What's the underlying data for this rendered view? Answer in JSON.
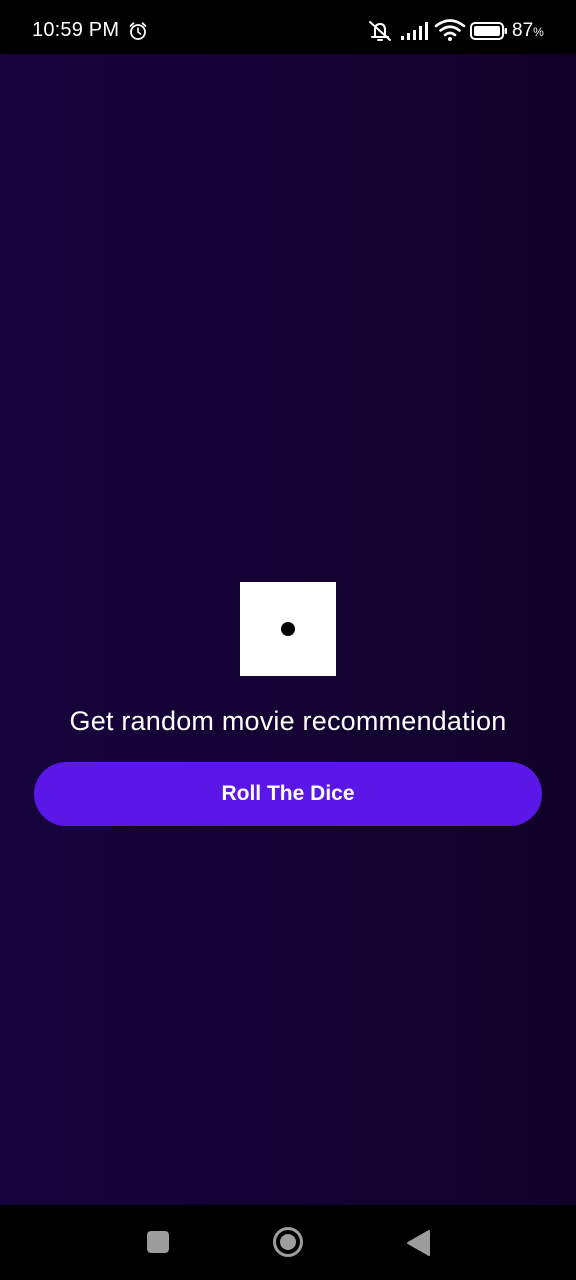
{
  "status_bar": {
    "time": "10:59 PM",
    "battery_level": "87",
    "battery_symbol": "%",
    "icons": [
      "alarm-icon",
      "mute-icon",
      "signal-icon",
      "wifi-icon",
      "battery-icon"
    ]
  },
  "main": {
    "dice_face": 1,
    "tagline": "Get random movie recommendation",
    "roll_button_label": "Roll The Dice"
  },
  "nav_bar": {
    "icons": [
      "recent-apps-icon",
      "home-icon",
      "back-icon"
    ]
  },
  "colors": {
    "background_left": "#17033d",
    "background_right": "#100129",
    "button": "#5a17e8",
    "text": "#ffffff"
  }
}
